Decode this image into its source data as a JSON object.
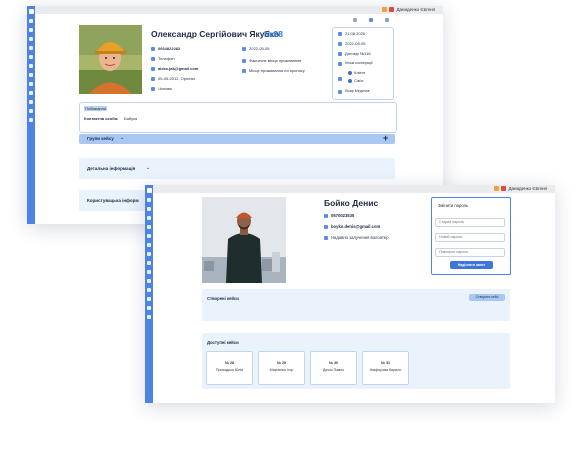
{
  "window1": {
    "topbar_user": "Даниденко Євгеня",
    "name": "Олександр Сергійович Якубко",
    "number": "№88",
    "left_info": [
      "0664822282",
      "Телефон",
      "aleks.jak@gmail.com",
      "05-05-2012, Орлеан",
      "Чоловік"
    ],
    "mid_info": [
      "2022-05-05",
      "Фактичне місце проживання",
      "Місце проживання по пропису"
    ],
    "right_info": [
      "21.08.2025",
      "2022-05-05",
      "Договір №116",
      "Кількі кооперації",
      "Клієнт",
      "Сім'я",
      "Лікар Медичне"
    ],
    "note_title": "Побажання",
    "contact_label": "Контактна особа:",
    "contact_value": "Бабуся",
    "sections": [
      "Групи кейсу",
      "Детальна інформація",
      "Користувацька інформ"
    ],
    "colors": {
      "accent": "#4d84e4",
      "number": "#2f7be0",
      "section_blue": "#a9c8f1",
      "panel": "#eaf2fc"
    }
  },
  "window2": {
    "topbar_user": "Даниденко Євгеня",
    "name": "Бойко Денис",
    "phone": "0670023535",
    "email": "boyko.denis@gmail.com",
    "volunteer_text": "Надавно залучення волонтер",
    "password_title": "Змінити пароль",
    "password_placeholders": [
      "Старий пароль",
      "Новий пароль",
      "Повторіть пароль"
    ],
    "password_button": "Надіслати запит",
    "create_title": "Створені кейси",
    "create_button": "Створити кейс",
    "available_title": "Доступні кейси",
    "cases": [
      {
        "number": "№ 28",
        "name": "Приходько Юлія"
      },
      {
        "number": "№ 29",
        "name": "Марченко Ігор"
      },
      {
        "number": "№ 30",
        "name": "Дячок Павло"
      },
      {
        "number": "№ 31",
        "name": "Нікіфорова Кирило"
      }
    ]
  }
}
